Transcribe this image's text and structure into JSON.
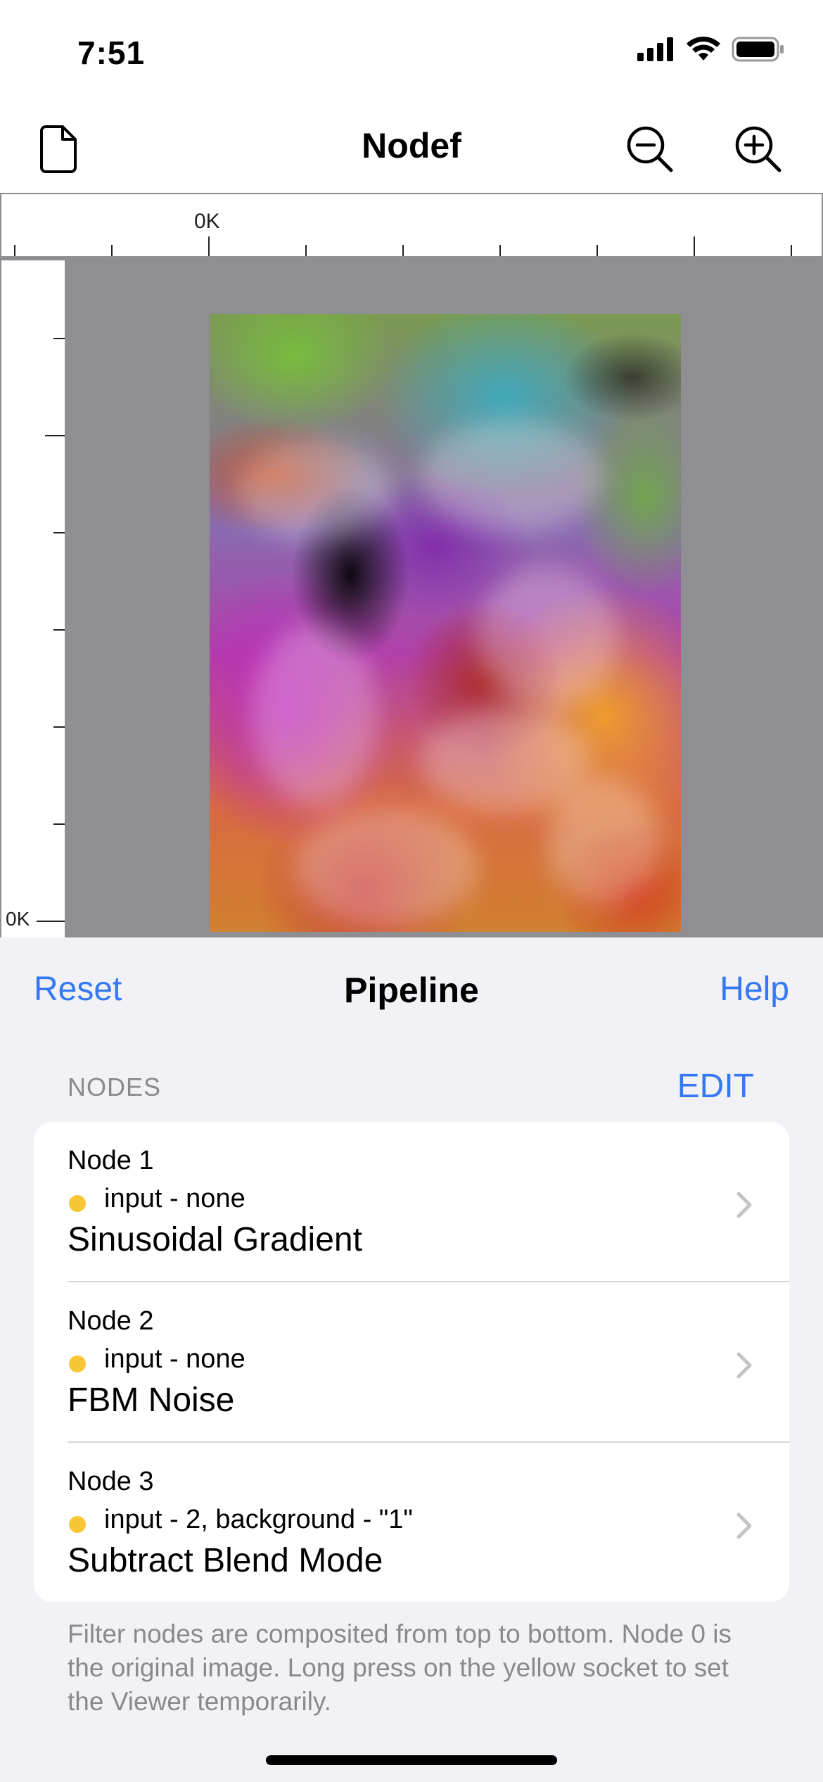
{
  "status_bar": {
    "time": "7:51",
    "icons": [
      "signal-icon",
      "wifi-icon",
      "battery-icon"
    ]
  },
  "nav": {
    "title": "Nodef",
    "left_icon": "document-icon",
    "right_icons": [
      "zoom-out-icon",
      "zoom-in-icon"
    ]
  },
  "canvas": {
    "ruler_top_label": "0K",
    "ruler_left_label": "0K",
    "background": "#8e8e93"
  },
  "pipeline": {
    "reset_label": "Reset",
    "title": "Pipeline",
    "help_label": "Help",
    "section_header": "NODES",
    "edit_label": "EDIT",
    "nodes": [
      {
        "name": "Node 1",
        "input": "input - none",
        "filter": "Sinusoidal Gradient"
      },
      {
        "name": "Node 2",
        "input": "input - none",
        "filter": "FBM Noise"
      },
      {
        "name": "Node 3",
        "input": "input - 2, background - \"1\"",
        "filter": "Subtract Blend Mode"
      }
    ],
    "footer": "Filter nodes are composited from top to bottom. Node 0 is the original image. Long press on the yellow socket to set the Viewer temporarily."
  },
  "colors": {
    "accent": "#3478f6",
    "socket": "#f7c736",
    "secondary_text": "#8a8a8e",
    "group_background": "#f2f1f6"
  }
}
